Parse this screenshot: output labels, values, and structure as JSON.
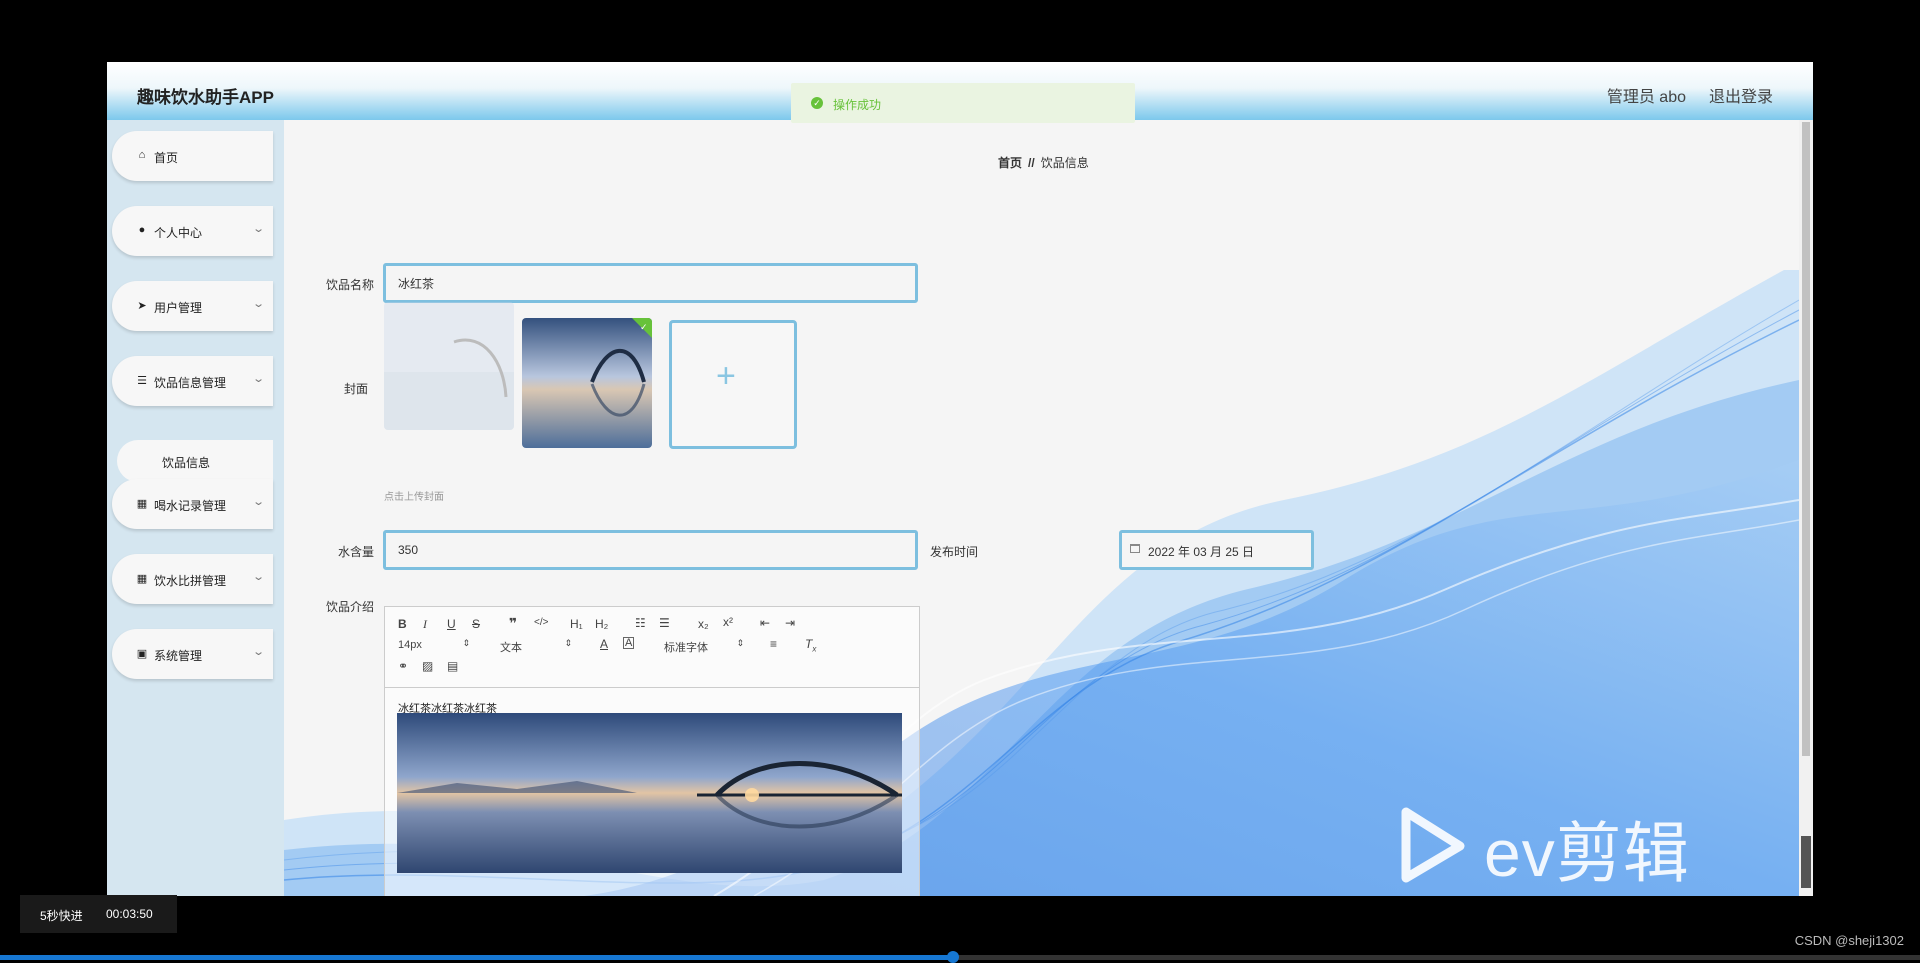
{
  "header": {
    "app_title": "趣味饮水助手APP",
    "admin_label": "管理员 abo",
    "logout_label": "退出登录"
  },
  "toast": {
    "message": "操作成功",
    "icon": "check-circle-icon",
    "color": "#67c23a"
  },
  "sidebar": {
    "items": [
      {
        "label": "首页",
        "icon": "home-icon"
      },
      {
        "label": "个人中心",
        "icon": "user-icon"
      },
      {
        "label": "用户管理",
        "icon": "send-icon"
      },
      {
        "label": "饮品信息管理",
        "icon": "list-icon"
      },
      {
        "label": "喝水记录管理",
        "icon": "grid-icon"
      },
      {
        "label": "饮水比拼管理",
        "icon": "grid-icon"
      },
      {
        "label": "系统管理",
        "icon": "clipboard-icon"
      }
    ],
    "sub_item": "饮品信息"
  },
  "breadcrumb": {
    "home": "首页",
    "separator": "//",
    "current": "饮品信息"
  },
  "form": {
    "name_label": "饮品名称",
    "name_value": "冰红茶",
    "cover_label": "封面",
    "upload_hint": "点击上传封面",
    "water_label": "水含量",
    "water_value": "350",
    "date_label": "发布时间",
    "date_value": "2022 年 03 月 25 日",
    "intro_label": "饮品介绍"
  },
  "editor": {
    "font_size": "14px",
    "paragraph": "文本",
    "font_family": "标准字体",
    "content_text": "冰红茶冰红茶冰红茶"
  },
  "watermark": "ev剪辑",
  "video": {
    "fast_forward": "5秒快进",
    "time": "00:03:50",
    "progress": 0.497
  },
  "credit": "CSDN @sheji1302",
  "colors": {
    "accent": "#7dbfdf",
    "sidebar": "#d5e6f0",
    "progress": "#1677d2"
  }
}
